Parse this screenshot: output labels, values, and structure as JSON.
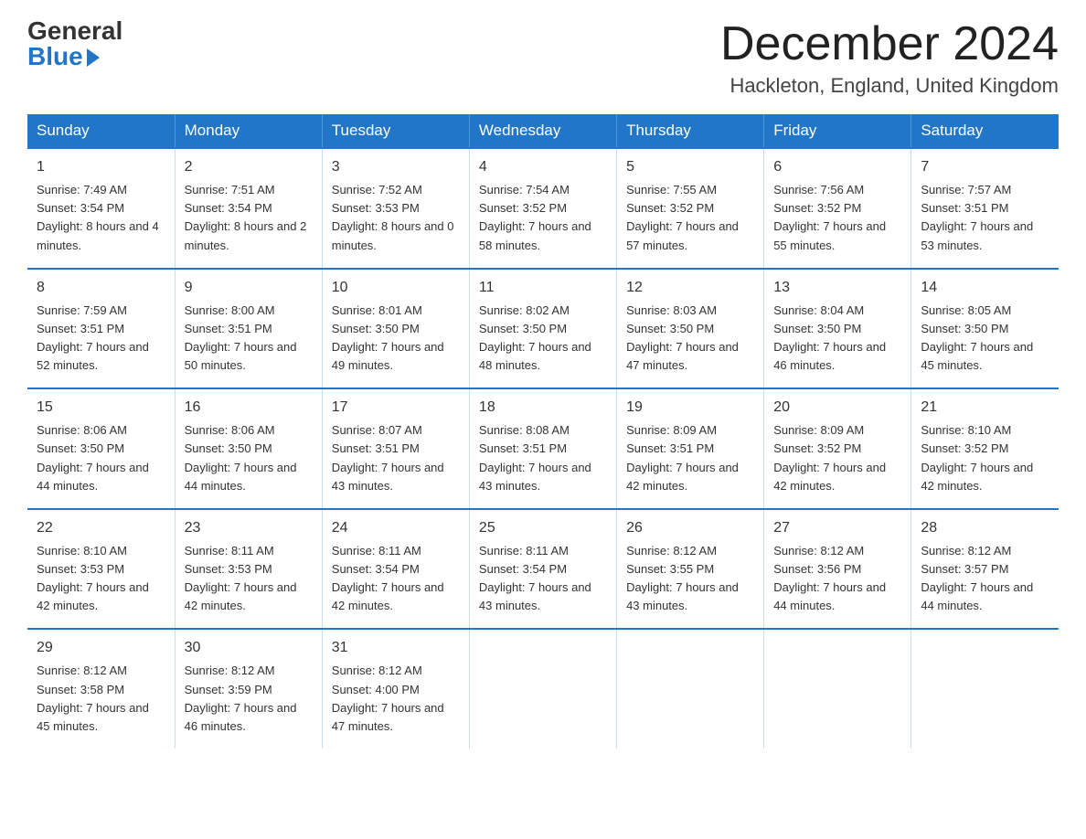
{
  "header": {
    "logo_general": "General",
    "logo_blue": "Blue",
    "month_title": "December 2024",
    "location": "Hackleton, England, United Kingdom"
  },
  "columns": [
    "Sunday",
    "Monday",
    "Tuesday",
    "Wednesday",
    "Thursday",
    "Friday",
    "Saturday"
  ],
  "weeks": [
    [
      {
        "day": "1",
        "sunrise": "7:49 AM",
        "sunset": "3:54 PM",
        "daylight": "8 hours and 4 minutes."
      },
      {
        "day": "2",
        "sunrise": "7:51 AM",
        "sunset": "3:54 PM",
        "daylight": "8 hours and 2 minutes."
      },
      {
        "day": "3",
        "sunrise": "7:52 AM",
        "sunset": "3:53 PM",
        "daylight": "8 hours and 0 minutes."
      },
      {
        "day": "4",
        "sunrise": "7:54 AM",
        "sunset": "3:52 PM",
        "daylight": "7 hours and 58 minutes."
      },
      {
        "day": "5",
        "sunrise": "7:55 AM",
        "sunset": "3:52 PM",
        "daylight": "7 hours and 57 minutes."
      },
      {
        "day": "6",
        "sunrise": "7:56 AM",
        "sunset": "3:52 PM",
        "daylight": "7 hours and 55 minutes."
      },
      {
        "day": "7",
        "sunrise": "7:57 AM",
        "sunset": "3:51 PM",
        "daylight": "7 hours and 53 minutes."
      }
    ],
    [
      {
        "day": "8",
        "sunrise": "7:59 AM",
        "sunset": "3:51 PM",
        "daylight": "7 hours and 52 minutes."
      },
      {
        "day": "9",
        "sunrise": "8:00 AM",
        "sunset": "3:51 PM",
        "daylight": "7 hours and 50 minutes."
      },
      {
        "day": "10",
        "sunrise": "8:01 AM",
        "sunset": "3:50 PM",
        "daylight": "7 hours and 49 minutes."
      },
      {
        "day": "11",
        "sunrise": "8:02 AM",
        "sunset": "3:50 PM",
        "daylight": "7 hours and 48 minutes."
      },
      {
        "day": "12",
        "sunrise": "8:03 AM",
        "sunset": "3:50 PM",
        "daylight": "7 hours and 47 minutes."
      },
      {
        "day": "13",
        "sunrise": "8:04 AM",
        "sunset": "3:50 PM",
        "daylight": "7 hours and 46 minutes."
      },
      {
        "day": "14",
        "sunrise": "8:05 AM",
        "sunset": "3:50 PM",
        "daylight": "7 hours and 45 minutes."
      }
    ],
    [
      {
        "day": "15",
        "sunrise": "8:06 AM",
        "sunset": "3:50 PM",
        "daylight": "7 hours and 44 minutes."
      },
      {
        "day": "16",
        "sunrise": "8:06 AM",
        "sunset": "3:50 PM",
        "daylight": "7 hours and 44 minutes."
      },
      {
        "day": "17",
        "sunrise": "8:07 AM",
        "sunset": "3:51 PM",
        "daylight": "7 hours and 43 minutes."
      },
      {
        "day": "18",
        "sunrise": "8:08 AM",
        "sunset": "3:51 PM",
        "daylight": "7 hours and 43 minutes."
      },
      {
        "day": "19",
        "sunrise": "8:09 AM",
        "sunset": "3:51 PM",
        "daylight": "7 hours and 42 minutes."
      },
      {
        "day": "20",
        "sunrise": "8:09 AM",
        "sunset": "3:52 PM",
        "daylight": "7 hours and 42 minutes."
      },
      {
        "day": "21",
        "sunrise": "8:10 AM",
        "sunset": "3:52 PM",
        "daylight": "7 hours and 42 minutes."
      }
    ],
    [
      {
        "day": "22",
        "sunrise": "8:10 AM",
        "sunset": "3:53 PM",
        "daylight": "7 hours and 42 minutes."
      },
      {
        "day": "23",
        "sunrise": "8:11 AM",
        "sunset": "3:53 PM",
        "daylight": "7 hours and 42 minutes."
      },
      {
        "day": "24",
        "sunrise": "8:11 AM",
        "sunset": "3:54 PM",
        "daylight": "7 hours and 42 minutes."
      },
      {
        "day": "25",
        "sunrise": "8:11 AM",
        "sunset": "3:54 PM",
        "daylight": "7 hours and 43 minutes."
      },
      {
        "day": "26",
        "sunrise": "8:12 AM",
        "sunset": "3:55 PM",
        "daylight": "7 hours and 43 minutes."
      },
      {
        "day": "27",
        "sunrise": "8:12 AM",
        "sunset": "3:56 PM",
        "daylight": "7 hours and 44 minutes."
      },
      {
        "day": "28",
        "sunrise": "8:12 AM",
        "sunset": "3:57 PM",
        "daylight": "7 hours and 44 minutes."
      }
    ],
    [
      {
        "day": "29",
        "sunrise": "8:12 AM",
        "sunset": "3:58 PM",
        "daylight": "7 hours and 45 minutes."
      },
      {
        "day": "30",
        "sunrise": "8:12 AM",
        "sunset": "3:59 PM",
        "daylight": "7 hours and 46 minutes."
      },
      {
        "day": "31",
        "sunrise": "8:12 AM",
        "sunset": "4:00 PM",
        "daylight": "7 hours and 47 minutes."
      },
      null,
      null,
      null,
      null
    ]
  ]
}
